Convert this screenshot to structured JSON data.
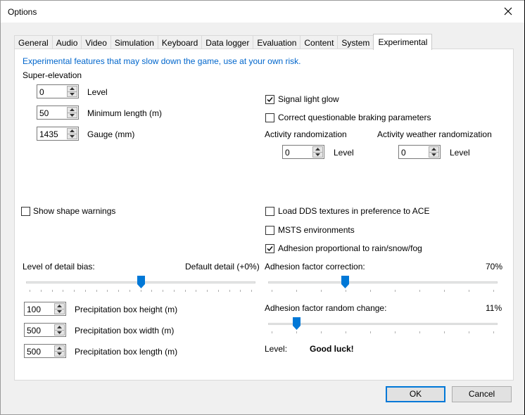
{
  "window": {
    "title": "Options"
  },
  "tabs": [
    "General",
    "Audio",
    "Video",
    "Simulation",
    "Keyboard",
    "Data logger",
    "Evaluation",
    "Content",
    "System",
    "Experimental"
  ],
  "active_tab": "Experimental",
  "note": "Experimental features that may slow down the game, use at your own risk.",
  "super_elevation": {
    "heading": "Super-elevation",
    "level": {
      "value": "0",
      "label": "Level"
    },
    "min_length": {
      "value": "50",
      "label": "Minimum length (m)"
    },
    "gauge": {
      "value": "1435",
      "label": "Gauge (mm)"
    }
  },
  "right_checks": {
    "signal_glow": {
      "label": "Signal light glow",
      "checked": true
    },
    "braking": {
      "label": "Correct questionable braking parameters",
      "checked": false
    }
  },
  "activity_rand": {
    "label": "Activity randomization",
    "value": "0",
    "level_label": "Level"
  },
  "weather_rand": {
    "label": "Activity weather randomization",
    "value": "0",
    "level_label": "Level"
  },
  "shape_warnings": {
    "label": "Show shape warnings",
    "checked": false
  },
  "dds": {
    "label": "Load DDS textures in preference to ACE",
    "checked": false
  },
  "msts_env": {
    "label": "MSTS environments",
    "checked": false
  },
  "adhesion_prop": {
    "label": "Adhesion proportional to rain/snow/fog",
    "checked": true
  },
  "lod": {
    "label": "Level of detail bias:",
    "value_text": "Default detail (+0%)",
    "position": 0.5
  },
  "adhesion_correction": {
    "label": "Adhesion factor correction:",
    "value_text": "70%",
    "position": 0.33
  },
  "adhesion_random": {
    "label": "Adhesion factor random change:",
    "value_text": "11%",
    "position": 0.11
  },
  "level_result": {
    "label": "Level:",
    "value": "Good luck!"
  },
  "precip": {
    "height": {
      "value": "100",
      "label": "Precipitation box height (m)"
    },
    "width": {
      "value": "500",
      "label": "Precipitation box width (m)"
    },
    "length": {
      "value": "500",
      "label": "Precipitation box length (m)"
    }
  },
  "buttons": {
    "ok": "OK",
    "cancel": "Cancel"
  },
  "colors": {
    "accent": "#0078d7",
    "note": "#0066cc"
  }
}
